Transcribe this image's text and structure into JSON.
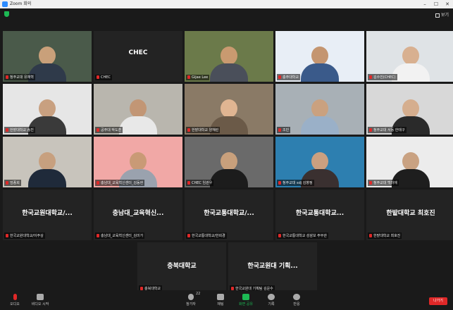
{
  "window": {
    "title": "Zoom 회의",
    "controls": [
      "–",
      "☐",
      "✕"
    ]
  },
  "view_label": "보기",
  "tiles": [
    {
      "id": 0,
      "name": "청주교대 유재혁",
      "kind": "video",
      "bg": "#4a5a4a",
      "skin": "#c9a07a",
      "shirt": "#2f3a4a"
    },
    {
      "id": 1,
      "name": "CHEC",
      "big": "CHEC",
      "kind": "name"
    },
    {
      "id": 2,
      "name": "Gijae Lee",
      "kind": "video",
      "bg": "#6b7a4a",
      "skin": "#c99a70",
      "shirt": "#4a4f5a",
      "speaker": true
    },
    {
      "id": 3,
      "name": "충주대학교",
      "kind": "video",
      "bg": "#e8eef6",
      "skin": "#c49570",
      "shirt": "#3a5a8a"
    },
    {
      "id": 4,
      "name": "김수진(CHEC)",
      "kind": "video",
      "bg": "#dfe3e6",
      "skin": "#d8b090",
      "shirt": "#f2f2f2"
    },
    {
      "id": 5,
      "name": "한밭대학교 송진",
      "kind": "video",
      "bg": "#e6e6e6",
      "skin": "#c8a080",
      "shirt": "#3a3a3a"
    },
    {
      "id": 6,
      "name": "공주대 박도훈",
      "kind": "video",
      "bg": "#b9b6ae",
      "skin": "#c29675",
      "shirt": "#e8e8e8"
    },
    {
      "id": 7,
      "name": "한밭대학교 양혜린",
      "kind": "video",
      "bg": "#8a7a66",
      "skin": "#e0b592",
      "shirt": "#6b5a48"
    },
    {
      "id": 8,
      "name": "조민",
      "kind": "video",
      "bg": "#a8b0b6",
      "skin": "#caa17f",
      "shirt": "#9ab0c8"
    },
    {
      "id": 9,
      "name": "청주교대 서동 한태구",
      "kind": "video",
      "bg": "#d8d8d8",
      "skin": "#d5ae8e",
      "shirt": "#2a2a2a"
    },
    {
      "id": 10,
      "name": "엄종희",
      "kind": "video",
      "bg": "#c8c4bc",
      "skin": "#c7a07f",
      "shirt": "#1f2a3a"
    },
    {
      "id": 11,
      "name": "충남대_교육혁신센터_김동현",
      "kind": "video",
      "bg": "#f1a8a6",
      "skin": "#c99a76",
      "shirt": "#9aa2ae"
    },
    {
      "id": 12,
      "name": "CHEC 임관우",
      "kind": "video",
      "bg": "#6a6a6a",
      "skin": "#c8a07c",
      "shirt": "#1c1c1c"
    },
    {
      "id": 13,
      "name": "청주교대 sdj 김향정",
      "kind": "video",
      "bg": "#2d7fb0",
      "skin": "#caa080",
      "shirt": "#3a3030"
    },
    {
      "id": 14,
      "name": "청주교대 백미애",
      "kind": "video",
      "bg": "#ececec",
      "skin": "#c9a282",
      "shirt": "#1e1e1e"
    },
    {
      "id": 15,
      "name": "한국교원대학교/이주상",
      "big": "한국교원대학교/...",
      "kind": "name"
    },
    {
      "id": 16,
      "name": "충남대_교육혁신센터_김미가",
      "big": "충남대_교육혁신...",
      "kind": "name"
    },
    {
      "id": 17,
      "name": "한국교통대학교/한희경",
      "big": "한국교통대학교/...",
      "kind": "name"
    },
    {
      "id": 18,
      "name": "한국교통대학교 성삼보 주무관",
      "big": "한국교통대학교...",
      "kind": "name"
    },
    {
      "id": 19,
      "name": "한밭대학교 최호진",
      "big": "한밭대학교 최호진",
      "kind": "name"
    },
    {
      "id": 20,
      "name": "충북대학교",
      "big": "충북대학교",
      "kind": "name"
    },
    {
      "id": 21,
      "name": "한국교원대 기획팀 김운수",
      "big": "한국교원대 기획...",
      "kind": "name"
    }
  ],
  "toolbar": {
    "mute": "오디오",
    "video": "비디오 시작",
    "participants": "참가자",
    "participants_count": "22",
    "chat": "채팅",
    "share": "화면 공유",
    "record": "기록",
    "reactions": "반응",
    "leave": "나가기"
  },
  "colors": {
    "accent": "#2d8cff",
    "share": "#1db954",
    "leave": "#e02828",
    "speaker_outline": "#e8e84a"
  }
}
